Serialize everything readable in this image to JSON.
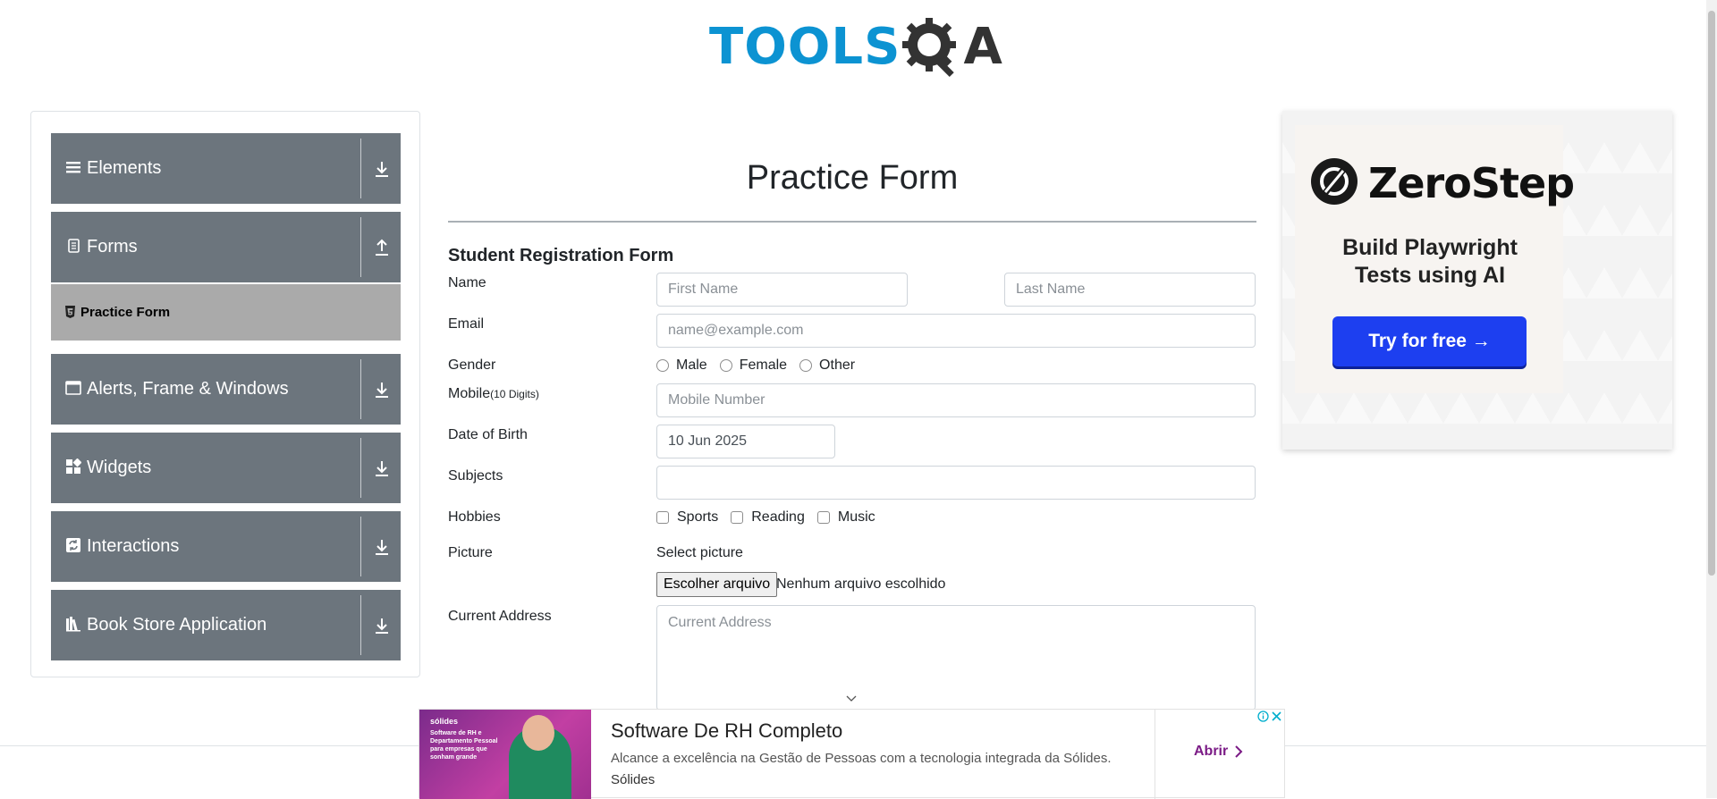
{
  "header": {
    "logo_text_left": "TOOLS",
    "logo_text_right": "A"
  },
  "sidebar": {
    "groups": [
      {
        "label": "Elements",
        "icon": "hamburger-icon"
      },
      {
        "label": "Forms",
        "icon": "document-icon",
        "expanded": true,
        "items": [
          {
            "label": "Practice Form",
            "icon": "html5-icon",
            "active": true
          }
        ]
      },
      {
        "label": "Alerts, Frame & Windows",
        "icon": "window-icon"
      },
      {
        "label": "Widgets",
        "icon": "widgets-icon"
      },
      {
        "label": "Interactions",
        "icon": "interactions-icon"
      },
      {
        "label": "Book Store Application",
        "icon": "books-icon"
      }
    ]
  },
  "form": {
    "title": "Practice Form",
    "subtitle": "Student Registration Form",
    "name_label": "Name",
    "first_name_placeholder": "First Name",
    "last_name_placeholder": "Last Name",
    "email_label": "Email",
    "email_placeholder": "name@example.com",
    "gender_label": "Gender",
    "gender_options": [
      "Male",
      "Female",
      "Other"
    ],
    "mobile_label": "Mobile",
    "mobile_hint": "(10 Digits)",
    "mobile_placeholder": "Mobile Number",
    "dob_label": "Date of Birth",
    "dob_value": "10 Jun 2025",
    "subjects_label": "Subjects",
    "subjects_value": "",
    "hobbies_label": "Hobbies",
    "hobbies_options": [
      "Sports",
      "Reading",
      "Music"
    ],
    "picture_label": "Picture",
    "picture_select_text": "Select picture",
    "file_button_label": "Escolher arquivo",
    "file_status": "Nenhum arquivo escolhido",
    "address_label": "Current Address",
    "address_placeholder": "Current Address"
  },
  "right_ad": {
    "brand": "ZeroStep",
    "tagline_line1": "Build Playwright",
    "tagline_line2": "Tests using AI",
    "cta": "Try for free →"
  },
  "bottom_ad": {
    "headline": "Software De RH Completo",
    "description": "Alcance a excelência na Gestão de Pessoas com a tecnologia integrada da Sólides.",
    "advertiser": "Sólides",
    "open_label": "Abrir",
    "image_brand": "sólides",
    "image_text": "Software de RH e Departamento Pessoal para empresas que sonham grande"
  },
  "colors": {
    "sidebar_group_bg": "#6c757d",
    "sidebar_active_bg": "#aaaaaa",
    "logo_blue": "#0c93d2",
    "cta_blue": "#1d3ff0"
  }
}
